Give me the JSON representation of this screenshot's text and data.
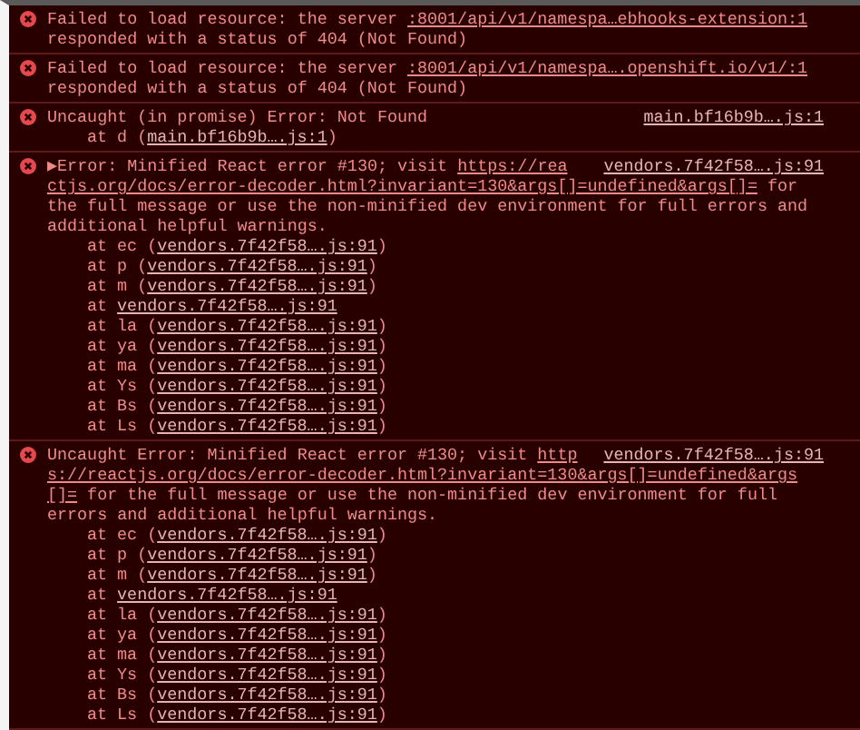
{
  "messages": [
    {
      "error": true,
      "lines": [
        {
          "kind": "text",
          "segments": [
            {
              "text": "Failed to load resource: the server ",
              "link": false
            },
            {
              "text": ":8001/api/v1/namespa…ebhooks-extension:1",
              "link": true
            }
          ]
        },
        {
          "kind": "text",
          "segments": [
            {
              "text": "responded with a status of 404 (Not Found)",
              "link": false
            }
          ]
        }
      ]
    },
    {
      "error": true,
      "lines": [
        {
          "kind": "text",
          "segments": [
            {
              "text": "Failed to load resource: the server ",
              "link": false
            },
            {
              "text": ":8001/api/v1/namespa….openshift.io/v1/:1",
              "link": true
            }
          ]
        },
        {
          "kind": "text",
          "segments": [
            {
              "text": "responded with a status of 404 (Not Found)",
              "link": false
            }
          ]
        }
      ]
    },
    {
      "error": true,
      "source": "main.bf16b9b….js:1",
      "lines": [
        {
          "kind": "text",
          "segments": [
            {
              "text": "Uncaught (in promise) Error: Not Found",
              "link": false
            }
          ]
        },
        {
          "kind": "frame",
          "segments": [
            {
              "text": "at d (",
              "link": false
            },
            {
              "text": "main.bf16b9b….js:1",
              "link": true
            },
            {
              "text": ")",
              "link": false
            }
          ]
        }
      ]
    },
    {
      "error": true,
      "source": "vendors.7f42f58….js:91",
      "lines": [
        {
          "kind": "text",
          "segments": [
            {
              "text": "▶",
              "link": false
            },
            {
              "text": "Error: Minified React error #130; visit ",
              "link": false
            },
            {
              "text": "https://rea",
              "link": true
            }
          ]
        },
        {
          "kind": "text",
          "segments": [
            {
              "text": "ctjs.org/docs/error-decoder.html?invariant=130&args[]=undefined&args[]=",
              "link": true
            },
            {
              "text": " for",
              "link": false
            }
          ]
        },
        {
          "kind": "text",
          "segments": [
            {
              "text": "the full message or use the non-minified dev environment for full errors and",
              "link": false
            }
          ]
        },
        {
          "kind": "text",
          "segments": [
            {
              "text": "additional helpful warnings.",
              "link": false
            }
          ]
        },
        {
          "kind": "frame",
          "segments": [
            {
              "text": "at ec (",
              "link": false
            },
            {
              "text": "vendors.7f42f58….js:91",
              "link": true
            },
            {
              "text": ")",
              "link": false
            }
          ]
        },
        {
          "kind": "frame",
          "segments": [
            {
              "text": "at p (",
              "link": false
            },
            {
              "text": "vendors.7f42f58….js:91",
              "link": true
            },
            {
              "text": ")",
              "link": false
            }
          ]
        },
        {
          "kind": "frame",
          "segments": [
            {
              "text": "at m (",
              "link": false
            },
            {
              "text": "vendors.7f42f58….js:91",
              "link": true
            },
            {
              "text": ")",
              "link": false
            }
          ]
        },
        {
          "kind": "frame",
          "segments": [
            {
              "text": "at ",
              "link": false
            },
            {
              "text": "vendors.7f42f58….js:91",
              "link": true
            }
          ]
        },
        {
          "kind": "frame",
          "segments": [
            {
              "text": "at la (",
              "link": false
            },
            {
              "text": "vendors.7f42f58….js:91",
              "link": true
            },
            {
              "text": ")",
              "link": false
            }
          ]
        },
        {
          "kind": "frame",
          "segments": [
            {
              "text": "at ya (",
              "link": false
            },
            {
              "text": "vendors.7f42f58….js:91",
              "link": true
            },
            {
              "text": ")",
              "link": false
            }
          ]
        },
        {
          "kind": "frame",
          "segments": [
            {
              "text": "at ma (",
              "link": false
            },
            {
              "text": "vendors.7f42f58….js:91",
              "link": true
            },
            {
              "text": ")",
              "link": false
            }
          ]
        },
        {
          "kind": "frame",
          "segments": [
            {
              "text": "at Ys (",
              "link": false
            },
            {
              "text": "vendors.7f42f58….js:91",
              "link": true
            },
            {
              "text": ")",
              "link": false
            }
          ]
        },
        {
          "kind": "frame",
          "segments": [
            {
              "text": "at Bs (",
              "link": false
            },
            {
              "text": "vendors.7f42f58….js:91",
              "link": true
            },
            {
              "text": ")",
              "link": false
            }
          ]
        },
        {
          "kind": "frame",
          "segments": [
            {
              "text": "at Ls (",
              "link": false
            },
            {
              "text": "vendors.7f42f58….js:91",
              "link": true
            },
            {
              "text": ")",
              "link": false
            }
          ]
        }
      ]
    },
    {
      "error": true,
      "source": "vendors.7f42f58….js:91",
      "lines": [
        {
          "kind": "text",
          "segments": [
            {
              "text": "Uncaught Error: Minified React error #130; visit ",
              "link": false
            },
            {
              "text": "http",
              "link": true
            }
          ]
        },
        {
          "kind": "text",
          "segments": [
            {
              "text": "s://reactjs.org/docs/error-decoder.html?invariant=130&args[]=undefined&args",
              "link": true
            }
          ]
        },
        {
          "kind": "text",
          "segments": [
            {
              "text": "[]=",
              "link": true
            },
            {
              "text": " for the full message or use the non-minified dev environment for full",
              "link": false
            }
          ]
        },
        {
          "kind": "text",
          "segments": [
            {
              "text": "errors and additional helpful warnings.",
              "link": false
            }
          ]
        },
        {
          "kind": "frame",
          "segments": [
            {
              "text": "at ec (",
              "link": false
            },
            {
              "text": "vendors.7f42f58….js:91",
              "link": true
            },
            {
              "text": ")",
              "link": false
            }
          ]
        },
        {
          "kind": "frame",
          "segments": [
            {
              "text": "at p (",
              "link": false
            },
            {
              "text": "vendors.7f42f58….js:91",
              "link": true
            },
            {
              "text": ")",
              "link": false
            }
          ]
        },
        {
          "kind": "frame",
          "segments": [
            {
              "text": "at m (",
              "link": false
            },
            {
              "text": "vendors.7f42f58….js:91",
              "link": true
            },
            {
              "text": ")",
              "link": false
            }
          ]
        },
        {
          "kind": "frame",
          "segments": [
            {
              "text": "at ",
              "link": false
            },
            {
              "text": "vendors.7f42f58….js:91",
              "link": true
            }
          ]
        },
        {
          "kind": "frame",
          "segments": [
            {
              "text": "at la (",
              "link": false
            },
            {
              "text": "vendors.7f42f58….js:91",
              "link": true
            },
            {
              "text": ")",
              "link": false
            }
          ]
        },
        {
          "kind": "frame",
          "segments": [
            {
              "text": "at ya (",
              "link": false
            },
            {
              "text": "vendors.7f42f58….js:91",
              "link": true
            },
            {
              "text": ")",
              "link": false
            }
          ]
        },
        {
          "kind": "frame",
          "segments": [
            {
              "text": "at ma (",
              "link": false
            },
            {
              "text": "vendors.7f42f58….js:91",
              "link": true
            },
            {
              "text": ")",
              "link": false
            }
          ]
        },
        {
          "kind": "frame",
          "segments": [
            {
              "text": "at Ys (",
              "link": false
            },
            {
              "text": "vendors.7f42f58….js:91",
              "link": true
            },
            {
              "text": ")",
              "link": false
            }
          ]
        },
        {
          "kind": "frame",
          "segments": [
            {
              "text": "at Bs (",
              "link": false
            },
            {
              "text": "vendors.7f42f58….js:91",
              "link": true
            },
            {
              "text": ")",
              "link": false
            }
          ]
        },
        {
          "kind": "frame",
          "segments": [
            {
              "text": "at Ls (",
              "link": false
            },
            {
              "text": "vendors.7f42f58….js:91",
              "link": true
            },
            {
              "text": ")",
              "link": false
            }
          ]
        }
      ]
    }
  ]
}
